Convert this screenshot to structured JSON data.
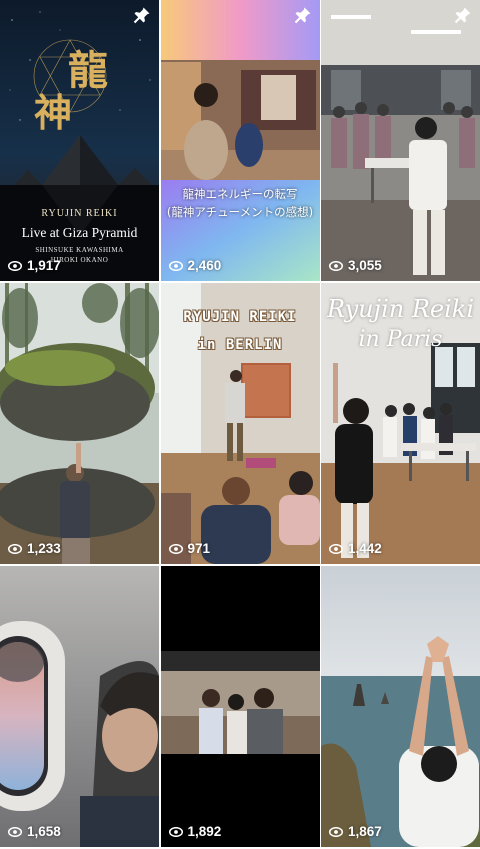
{
  "posts": [
    {
      "views": "1,917",
      "pinned": true,
      "kanji_top": "龍",
      "kanji_bottom": "神",
      "overlay_lines": [
        "RYUJIN REIKI",
        "Live at Giza Pyramid",
        "SHINSUKE KAWASHIMA",
        "HIROKI OKANO"
      ]
    },
    {
      "views": "2,460",
      "pinned": true,
      "overlay_lines": [
        "龍神エネルギーの転写",
        "(龍神アチューメントの感想)"
      ]
    },
    {
      "views": "3,055",
      "pinned": true
    },
    {
      "views": "1,233",
      "pinned": false
    },
    {
      "views": "971",
      "pinned": false,
      "overlay_lines": [
        "RYUJIN REIKI",
        "in BERLIN"
      ]
    },
    {
      "views": "1,442",
      "pinned": false,
      "overlay_lines": [
        "Ryujin Reiki",
        "in Paris"
      ]
    },
    {
      "views": "1,658",
      "pinned": false
    },
    {
      "views": "1,892",
      "pinned": false
    },
    {
      "views": "1,867",
      "pinned": false
    }
  ],
  "icons": {
    "views": "play-outline-icon",
    "pinned": "pushpin-icon"
  },
  "colors": {
    "overlay_text": "#ffffff",
    "kanji_gold": "#d9b15e",
    "background": "#ffffff"
  }
}
